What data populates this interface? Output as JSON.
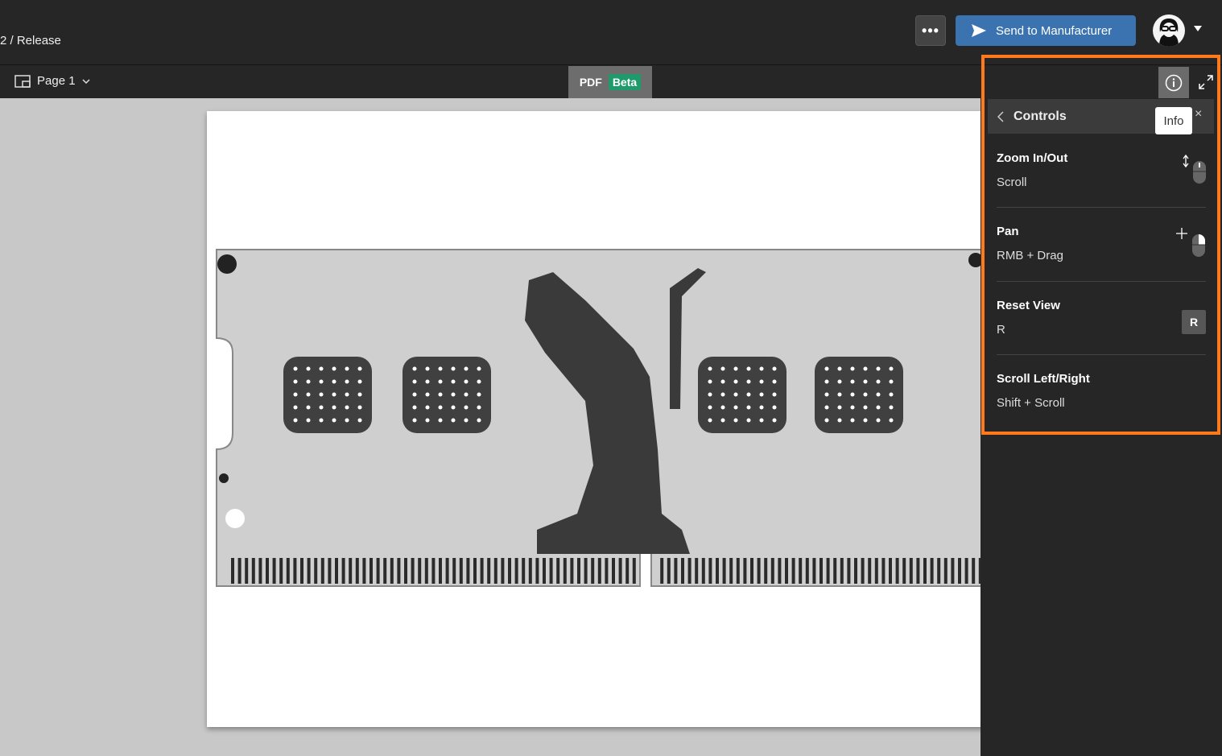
{
  "header": {
    "breadcrumb": "2 / Release",
    "more_label": "•••",
    "send_label": "Send to Manufacturer",
    "send_icon": "send-icon",
    "avatar_icon": "user-avatar"
  },
  "toolbar": {
    "page_label": "Page 1",
    "pdf_label": "PDF",
    "beta_label": "Beta"
  },
  "panel": {
    "title": "Controls",
    "tooltip": "Info",
    "close_label": "×",
    "controls": [
      {
        "title": "Zoom In/Out",
        "keys": "Scroll",
        "icon": "mouse-scroll-icon"
      },
      {
        "title": "Pan",
        "keys": "RMB + Drag",
        "icon": "mouse-right-drag-icon"
      },
      {
        "title": "Reset View",
        "keys": "R",
        "keycap": "R"
      },
      {
        "title": "Scroll Left/Right",
        "keys": "Shift + Scroll"
      }
    ]
  },
  "colors": {
    "accent": "#3a73b0",
    "highlight": "#ff7a1a",
    "beta": "#1f9a6c"
  }
}
